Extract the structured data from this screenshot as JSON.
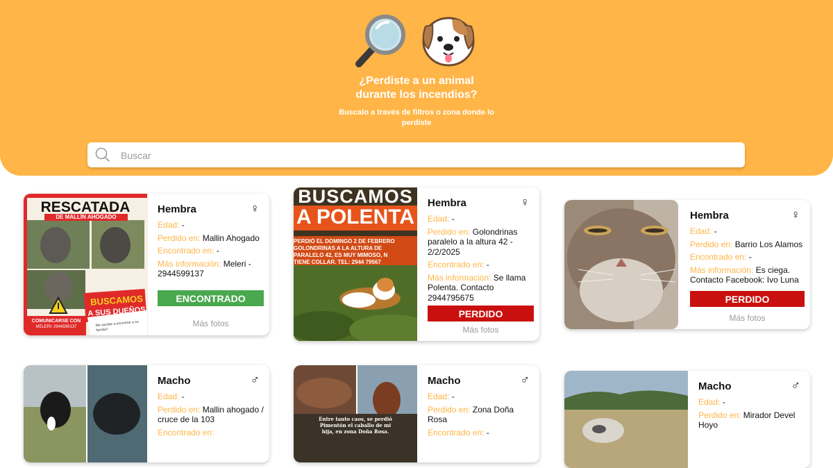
{
  "hero": {
    "title_line1": "¿Perdiste a un animal",
    "title_line2": "durante los incendios?",
    "subtitle_line1": "Buscalo a través de filtros o zona donde lo",
    "subtitle_line2": "perdiste",
    "bg_color": "#ffb547"
  },
  "search": {
    "placeholder": "Buscar",
    "value": ""
  },
  "labels": {
    "edad": "Edad:",
    "perdido": "Perdido en:",
    "encontrado": "Encontrado en:",
    "mas_info": "Más información:",
    "mas_fotos": "Más fotos"
  },
  "status_colors": {
    "encontrado": "#4aa84e",
    "perdido": "#c9100e"
  },
  "cards": [
    {
      "sex": "Hembra",
      "sex_symbol": "♀",
      "edad": "-",
      "perdido": "Mallin Ahogado",
      "encontrado": "-",
      "mas_info_l1": "Meleri -",
      "mas_info_l2": "2944599137",
      "status": "ENCONTRADO",
      "poster_title": "RESCATADA",
      "poster_sub": "DE MALLÍN AHOGADO",
      "poster_b1": "BUSCAMOS",
      "poster_b2": "A SUS DUEÑOS",
      "poster_c1": "COMUNICARSE CON",
      "poster_c2": "MELERI: 2944599137",
      "poster_q": "Me ayudas a encontrar a su familia?"
    },
    {
      "sex": "Hembra",
      "sex_symbol": "♀",
      "edad": "-",
      "perdido_l1": "Golondrinas",
      "perdido_l2": "paralelo a la altura 42 -",
      "perdido_l3": "2/2/2025",
      "encontrado": "-",
      "mas_info_l1": "Se llama",
      "mas_info_l2": "Polenta. Contacto",
      "mas_info_l3": "2944795675",
      "status": "PERDIDO",
      "poster_title1": "BUSCAMOS",
      "poster_title2": "A POLENTA",
      "poster_t1": "PERDIÓ EL DOMINGO 2 DE FEBRERO",
      "poster_t2": "GOLONDRINAS A LA ALTURA DE",
      "poster_t3": "PARALELO 42, ES MUY MIMOSO, N",
      "poster_t4": "TIENE COLLAR. TEL: 2944 79567"
    },
    {
      "sex": "Hembra",
      "sex_symbol": "♀",
      "edad": "-",
      "perdido": "Barrio Los Alamos",
      "encontrado": "-",
      "mas_info_l1": "Es ciega.",
      "mas_info_l2": "Contacto Facebook: Ivo Luna",
      "status": "PERDIDO"
    },
    {
      "sex": "Macho",
      "sex_symbol": "♂",
      "edad": "-",
      "perdido_l1": "Mallin ahogado /",
      "perdido_l2": "cruce de la 103",
      "encontrado": ""
    },
    {
      "sex": "Macho",
      "sex_symbol": "♂",
      "edad": "-",
      "perdido": "Zona Doña Rosa",
      "encontrado": "-",
      "poster_t1": "Entre tanto caos, se perdió",
      "poster_t2": "Pimentón el caballo de mi",
      "poster_t3": "hija, en zona Doña Rosa."
    },
    {
      "sex": "Macho",
      "sex_symbol": "♂",
      "edad": "-",
      "perdido_l1": "Mirador Devel",
      "perdido_l2": "Hoyo"
    }
  ]
}
